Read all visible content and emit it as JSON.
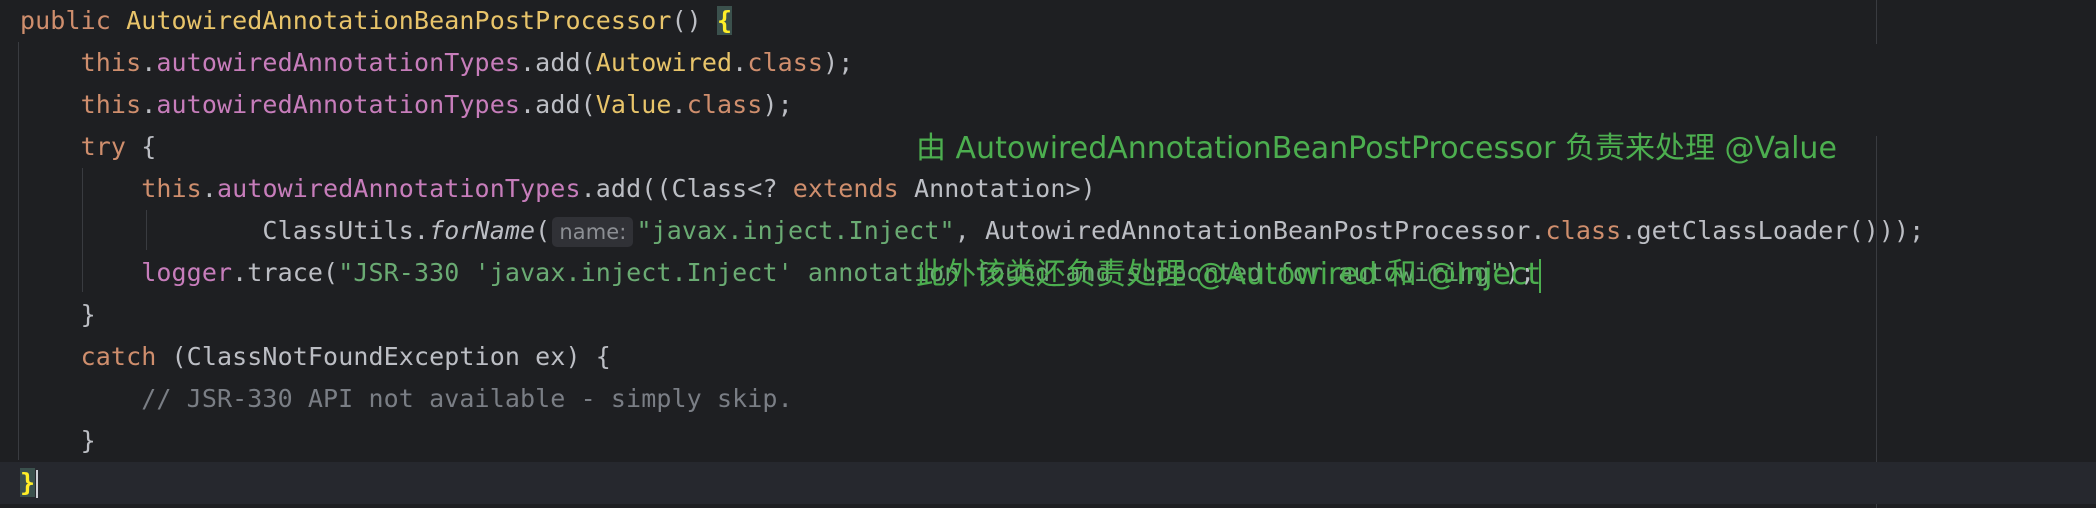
{
  "editor": {
    "lines": [
      {
        "parts": [
          {
            "t": "public ",
            "c": "kw"
          },
          {
            "t": "AutowiredAnnotationBeanPostProcessor",
            "c": "decl"
          },
          {
            "t": "() ",
            "c": ""
          },
          {
            "t": "{",
            "c": "brace-match"
          }
        ]
      },
      {
        "parts": [
          {
            "t": "    ",
            "c": ""
          },
          {
            "t": "this",
            "c": "kw"
          },
          {
            "t": ".",
            "c": ""
          },
          {
            "t": "autowiredAnnotationTypes",
            "c": "field"
          },
          {
            "t": ".add(",
            "c": ""
          },
          {
            "t": "Autowired",
            "c": "cls"
          },
          {
            "t": ".",
            "c": ""
          },
          {
            "t": "class",
            "c": "kw"
          },
          {
            "t": ");",
            "c": ""
          }
        ]
      },
      {
        "parts": [
          {
            "t": "    ",
            "c": ""
          },
          {
            "t": "this",
            "c": "kw"
          },
          {
            "t": ".",
            "c": ""
          },
          {
            "t": "autowiredAnnotationTypes",
            "c": "field"
          },
          {
            "t": ".add(",
            "c": ""
          },
          {
            "t": "Value",
            "c": "cls"
          },
          {
            "t": ".",
            "c": ""
          },
          {
            "t": "class",
            "c": "kw"
          },
          {
            "t": ");",
            "c": ""
          }
        ]
      },
      {
        "parts": [
          {
            "t": "    ",
            "c": ""
          },
          {
            "t": "try",
            "c": "kw"
          },
          {
            "t": " {",
            "c": ""
          }
        ]
      },
      {
        "parts": [
          {
            "t": "        ",
            "c": ""
          },
          {
            "t": "this",
            "c": "kw"
          },
          {
            "t": ".",
            "c": ""
          },
          {
            "t": "autowiredAnnotationTypes",
            "c": "field"
          },
          {
            "t": ".add((Class<? ",
            "c": ""
          },
          {
            "t": "extends",
            "c": "kw"
          },
          {
            "t": " Annotation>)",
            "c": ""
          }
        ]
      },
      {
        "parts": [
          {
            "t": "                ",
            "c": ""
          },
          {
            "t": "ClassUtils.",
            "c": ""
          },
          {
            "t": "forName",
            "c": "ital"
          },
          {
            "t": "(",
            "c": ""
          },
          {
            "t": "name:",
            "c": "hint"
          },
          {
            "t": "\"javax.inject.Inject\"",
            "c": "str"
          },
          {
            "t": ", AutowiredAnnotationBeanPostProcessor.",
            "c": ""
          },
          {
            "t": "class",
            "c": "kw"
          },
          {
            "t": ".getClassLoader()));",
            "c": ""
          }
        ]
      },
      {
        "parts": [
          {
            "t": "        ",
            "c": ""
          },
          {
            "t": "logger",
            "c": "field"
          },
          {
            "t": ".trace(",
            "c": ""
          },
          {
            "t": "\"JSR-330 'javax.inject.Inject' annotation found and supported for autowiring\"",
            "c": "str"
          },
          {
            "t": ");",
            "c": ""
          }
        ]
      },
      {
        "parts": [
          {
            "t": "    }",
            "c": ""
          }
        ]
      },
      {
        "parts": [
          {
            "t": "    ",
            "c": ""
          },
          {
            "t": "catch",
            "c": "kw"
          },
          {
            "t": " (ClassNotFoundException ex) {",
            "c": ""
          }
        ]
      },
      {
        "parts": [
          {
            "t": "        ",
            "c": ""
          },
          {
            "t": "// JSR-330 API not available - simply skip.",
            "c": "cmt"
          }
        ]
      },
      {
        "parts": [
          {
            "t": "    }",
            "c": ""
          }
        ]
      },
      {
        "parts": [
          {
            "t": "}",
            "c": "brace-match"
          }
        ],
        "current": true,
        "caret": true
      }
    ]
  },
  "annotation": {
    "line1": "由 AutowiredAnnotationBeanPostProcessor 负责来处理 @Value",
    "line2": "此外该类还负责处理 @Autowired 和 @Inject"
  },
  "colors": {
    "background": "#1e1f22",
    "keyword": "#cf8e6d",
    "field": "#c77dbb",
    "class": "#e8c46a",
    "string": "#6aab73",
    "comment": "#7a7e85",
    "annotation_text": "#4cae4f"
  }
}
